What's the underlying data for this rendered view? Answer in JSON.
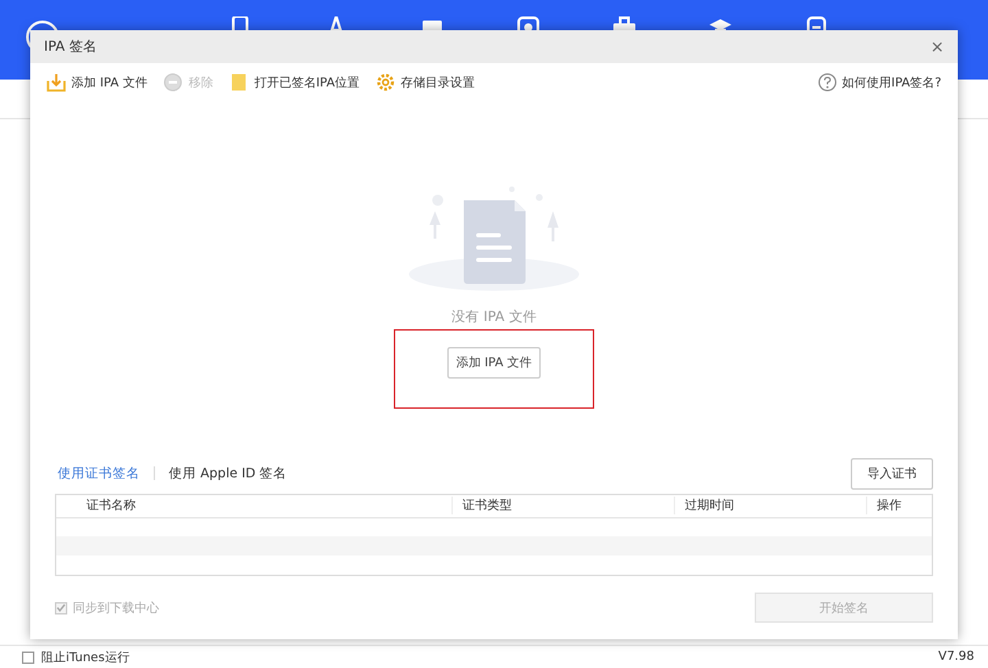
{
  "app": {
    "status_bar": {
      "block_itunes": {
        "label": "阻止iTunes运行",
        "checked": false
      },
      "version": "V7.98"
    }
  },
  "dialog": {
    "title": "IPA 签名",
    "close": "×",
    "toolbar": [
      {
        "kind": "add",
        "label": "添加 IPA 文件",
        "disabled": false
      },
      {
        "kind": "remove",
        "label": "移除",
        "disabled": true
      },
      {
        "kind": "folder",
        "label": "打开已签名IPA位置",
        "disabled": false
      },
      {
        "kind": "gear",
        "label": "存储目录设置",
        "disabled": false
      }
    ],
    "help": "如何使用IPA签名?",
    "empty_message": "没有 IPA 文件",
    "add_button": "添加 IPA 文件",
    "tabs": [
      {
        "label": "使用证书签名",
        "selected": true
      },
      {
        "label": "使用 Apple ID 签名",
        "selected": false
      }
    ],
    "import_button": "导入证书",
    "table": {
      "columns": [
        "证书名称",
        "证书类型",
        "过期时间",
        "操作"
      ]
    },
    "sync": {
      "label": "同步到下载中心",
      "checked": true,
      "disabled": true
    },
    "start_button": {
      "label": "开始签名",
      "disabled": true
    }
  }
}
